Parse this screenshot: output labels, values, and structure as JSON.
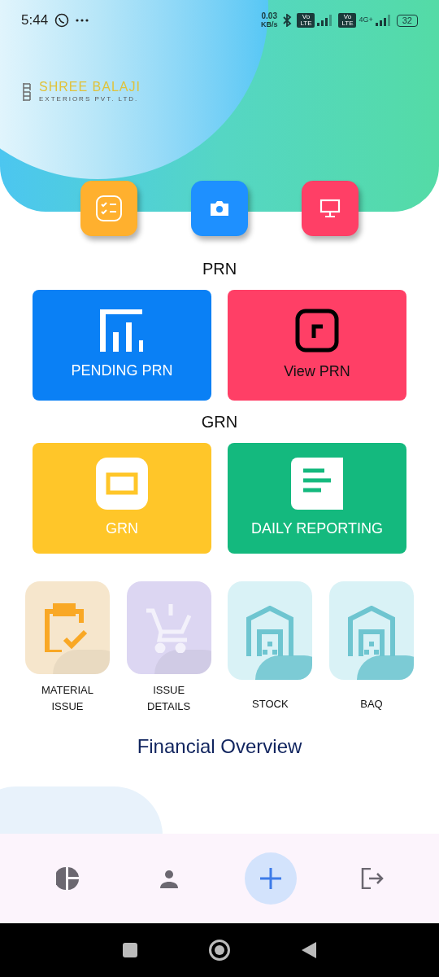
{
  "status_bar": {
    "time": "5:44",
    "data_rate": "0.03",
    "data_unit": "KB/s",
    "sim_badges": [
      "Vo LTE",
      "Vo LTE"
    ],
    "network": "4G+",
    "battery": "32"
  },
  "logo": {
    "name": "SHREE BALAJI",
    "subtitle": "EXTERIORS PVT. LTD."
  },
  "quick_actions": [
    {
      "kind": "checklist",
      "color": "#ffb02e"
    },
    {
      "kind": "camera",
      "color": "#1e90ff"
    },
    {
      "kind": "monitor",
      "color": "#ff3f66"
    }
  ],
  "sections": [
    {
      "title": "PRN",
      "cards": [
        {
          "label": "PENDING PRN",
          "kind": "chart",
          "color": "#0a80f5",
          "dark_text": false
        },
        {
          "label": "View PRN",
          "kind": "square",
          "color": "#ff3f66",
          "dark_text": true
        }
      ]
    },
    {
      "title": "GRN",
      "cards": [
        {
          "label": "GRN",
          "kind": "frame",
          "color": "#ffc629",
          "dark_text": false
        },
        {
          "label": "DAILY REPORTING",
          "kind": "document",
          "color": "#14b97e",
          "dark_text": false
        }
      ]
    }
  ],
  "tiles": [
    {
      "label": "MATERIAL ISSUE",
      "kind": "clipboard",
      "color": "#f6e6cc"
    },
    {
      "label": "ISSUE DETAILS",
      "kind": "cart",
      "color": "#dcd6f2"
    },
    {
      "label": "STOCK",
      "kind": "warehouse",
      "color": "#d9f2f6"
    },
    {
      "label": "BAQ",
      "kind": "warehouse",
      "color": "#d9f2f6"
    }
  ],
  "financial_overview": {
    "title": "Financial Overview"
  },
  "bottom_nav": [
    {
      "kind": "pie",
      "selected": false
    },
    {
      "kind": "person",
      "selected": false
    },
    {
      "kind": "add",
      "selected": true
    },
    {
      "kind": "logout",
      "selected": false
    }
  ]
}
